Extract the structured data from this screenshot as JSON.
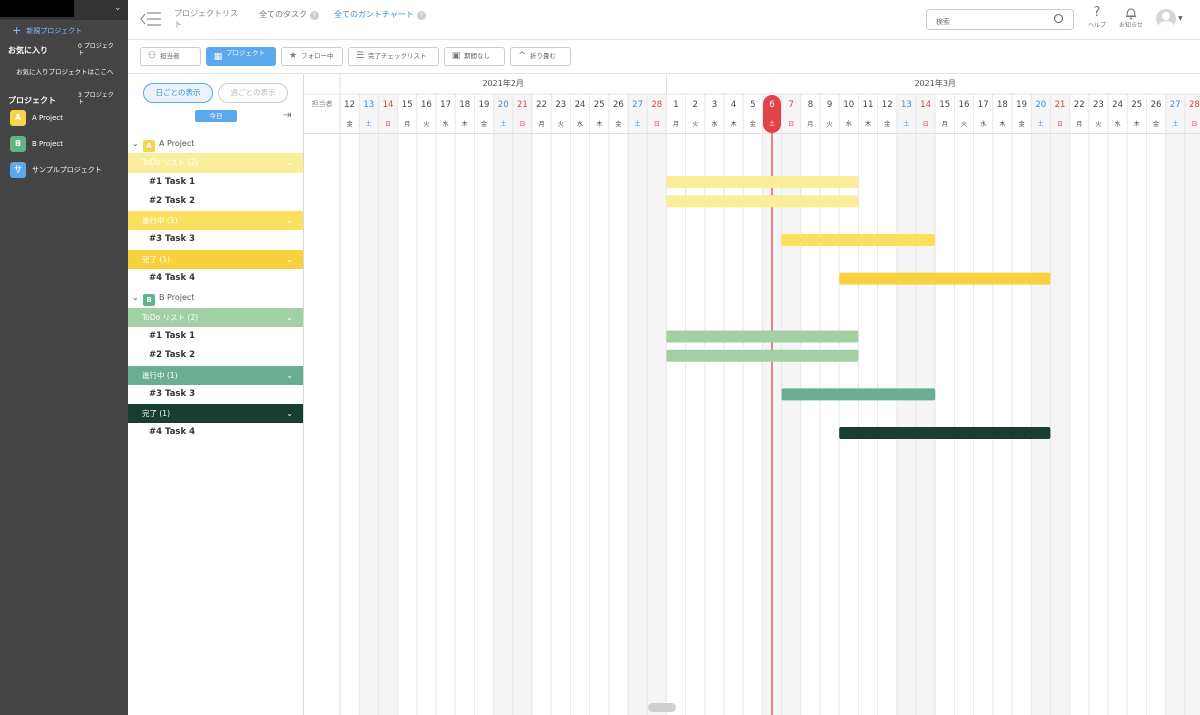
{
  "sidebar": {
    "new_project": "新規プロジェクト",
    "favorites": {
      "heading": "お気に入り",
      "count": "0 プロジェクト",
      "empty": "お気に入りプロジェクトはここへ"
    },
    "projects": {
      "heading": "プロジェクト",
      "count": "3 プロジェクト",
      "items": [
        {
          "badge": "A",
          "name": "A Project",
          "color": "#f4d64e"
        },
        {
          "badge": "B",
          "name": "B Project",
          "color": "#5fb58a"
        },
        {
          "badge": "サ",
          "name": "サンプルプロジェクト",
          "color": "#5ba8ec"
        }
      ]
    }
  },
  "header": {
    "nav_list": "プロジェクトリスト",
    "nav_tasks": "全てのタスク",
    "nav_gantt": "全てのガントチャート",
    "help_mark": "?",
    "search_placeholder": "検索",
    "help_label": "ヘルプ",
    "notice_label": "お知らせ"
  },
  "toolbar": {
    "assignee": "担当者",
    "project": "プロジェクト",
    "following": "フォロー中",
    "checklist": "完了チェックリスト",
    "no_deadline": "期間なし",
    "collapse": "折り畳む"
  },
  "left": {
    "view_day": "日ごとの表示",
    "view_week": "週ごとの表示",
    "today": "今日"
  },
  "tree": [
    {
      "type": "proj",
      "badge": "A",
      "name": "A Project",
      "color": "#f4d64e"
    },
    {
      "type": "grp",
      "label": "ToDo リスト (2)",
      "color": "#fbee9b"
    },
    {
      "type": "task",
      "label": "#1 Task 1"
    },
    {
      "type": "task",
      "label": "#2 Task 2"
    },
    {
      "type": "grp",
      "label": "進行中 (1)",
      "color": "#f9e15f"
    },
    {
      "type": "task",
      "label": "#3 Task 3"
    },
    {
      "type": "grp",
      "label": "完了 (1)",
      "color": "#f7d23f"
    },
    {
      "type": "task",
      "label": "#4 Task 4"
    },
    {
      "type": "proj",
      "badge": "B",
      "name": "B Project",
      "color": "#5fb58a"
    },
    {
      "type": "grp",
      "label": "ToDo リスト (2)",
      "color": "#a3cfa5"
    },
    {
      "type": "task",
      "label": "#1 Task 1"
    },
    {
      "type": "task",
      "label": "#2 Task 2"
    },
    {
      "type": "grp",
      "label": "進行中 (1)",
      "color": "#69ad93"
    },
    {
      "type": "task",
      "label": "#3 Task 3"
    },
    {
      "type": "grp",
      "label": "完了 (1)",
      "color": "#173e2f"
    },
    {
      "type": "task",
      "label": "#4 Task 4"
    }
  ],
  "gantt": {
    "assignee_col": "担当者",
    "months": [
      {
        "label": "2021年2月",
        "start_index": 0
      },
      {
        "label": "2021年3月",
        "start_index": 17
      }
    ],
    "days": [
      {
        "d": "12",
        "w": "金"
      },
      {
        "d": "13",
        "w": "土"
      },
      {
        "d": "14",
        "w": "日"
      },
      {
        "d": "15",
        "w": "月"
      },
      {
        "d": "16",
        "w": "火"
      },
      {
        "d": "17",
        "w": "水"
      },
      {
        "d": "18",
        "w": "木"
      },
      {
        "d": "19",
        "w": "金"
      },
      {
        "d": "20",
        "w": "土"
      },
      {
        "d": "21",
        "w": "日"
      },
      {
        "d": "22",
        "w": "月"
      },
      {
        "d": "23",
        "w": "火"
      },
      {
        "d": "24",
        "w": "水"
      },
      {
        "d": "25",
        "w": "木"
      },
      {
        "d": "26",
        "w": "金"
      },
      {
        "d": "27",
        "w": "土"
      },
      {
        "d": "28",
        "w": "日"
      },
      {
        "d": "1",
        "w": "月"
      },
      {
        "d": "2",
        "w": "火"
      },
      {
        "d": "3",
        "w": "水"
      },
      {
        "d": "4",
        "w": "木"
      },
      {
        "d": "5",
        "w": "金"
      },
      {
        "d": "6",
        "w": "土"
      },
      {
        "d": "7",
        "w": "日"
      },
      {
        "d": "8",
        "w": "月"
      },
      {
        "d": "9",
        "w": "火"
      },
      {
        "d": "10",
        "w": "水"
      },
      {
        "d": "11",
        "w": "木"
      },
      {
        "d": "12",
        "w": "金"
      },
      {
        "d": "13",
        "w": "土"
      },
      {
        "d": "14",
        "w": "日"
      },
      {
        "d": "15",
        "w": "月"
      },
      {
        "d": "16",
        "w": "火"
      },
      {
        "d": "17",
        "w": "水"
      },
      {
        "d": "18",
        "w": "木"
      },
      {
        "d": "19",
        "w": "金"
      },
      {
        "d": "20",
        "w": "土"
      },
      {
        "d": "21",
        "w": "日"
      },
      {
        "d": "22",
        "w": "月"
      },
      {
        "d": "23",
        "w": "火"
      },
      {
        "d": "24",
        "w": "水"
      },
      {
        "d": "25",
        "w": "木"
      },
      {
        "d": "26",
        "w": "金"
      },
      {
        "d": "27",
        "w": "土"
      },
      {
        "d": "28",
        "w": "日"
      }
    ],
    "today_index": 22,
    "colors": {
      "sat": "#3a8fd9",
      "sun": "#e0434a",
      "today": "#e0434a"
    },
    "bars": [
      {
        "row": 2,
        "start": 17,
        "end": 27,
        "color": "#fbee9b"
      },
      {
        "row": 3,
        "start": 17,
        "end": 27,
        "color": "#fbee9b"
      },
      {
        "row": 5,
        "start": 23,
        "end": 31,
        "color": "#f9e15f"
      },
      {
        "row": 7,
        "start": 26,
        "end": 37,
        "color": "#f7d23f"
      },
      {
        "row": 10,
        "start": 17,
        "end": 27,
        "color": "#a3cfa5"
      },
      {
        "row": 11,
        "start": 17,
        "end": 27,
        "color": "#a3cfa5"
      },
      {
        "row": 13,
        "start": 23,
        "end": 31,
        "color": "#69ad93"
      },
      {
        "row": 15,
        "start": 26,
        "end": 37,
        "color": "#173e2f"
      }
    ]
  }
}
